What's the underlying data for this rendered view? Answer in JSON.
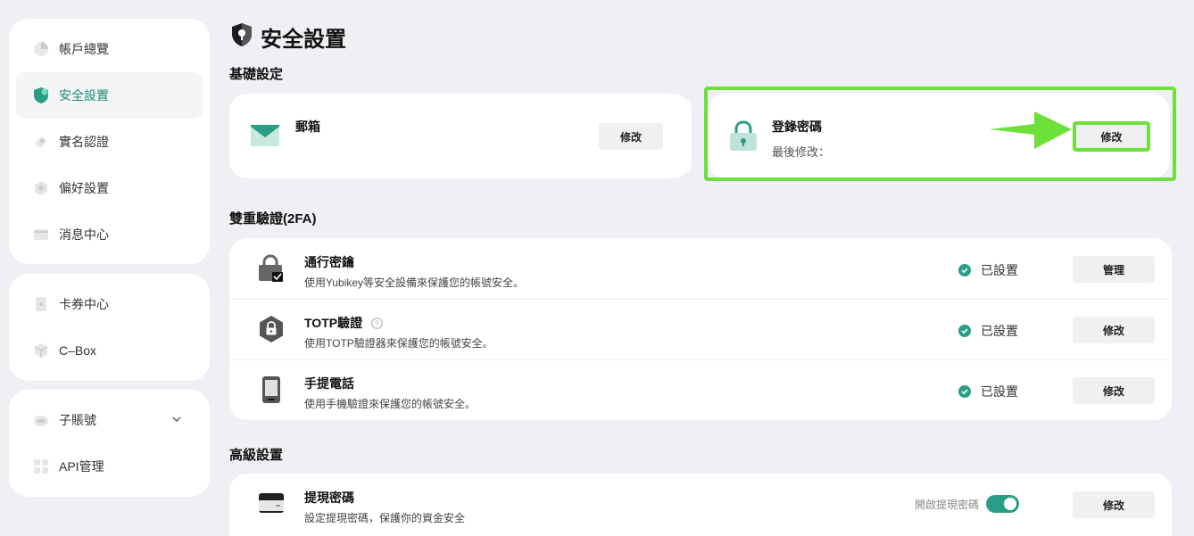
{
  "sidebar": {
    "group1": [
      {
        "label": "帳戶總覽",
        "icon": "pie-chart-icon"
      },
      {
        "label": "安全設置",
        "icon": "shield-icon",
        "active": true
      },
      {
        "label": "實名認證",
        "icon": "id-badge-icon"
      },
      {
        "label": "偏好設置",
        "icon": "settings-icon"
      },
      {
        "label": "消息中心",
        "icon": "message-icon"
      }
    ],
    "group2": [
      {
        "label": "卡券中心",
        "icon": "coupon-icon"
      },
      {
        "label": "C–Box",
        "icon": "box-icon"
      }
    ],
    "group3": [
      {
        "label": "子賬號",
        "icon": "sub-account-icon"
      },
      {
        "label": "API管理",
        "icon": "api-icon"
      }
    ]
  },
  "page": {
    "title": "安全設置",
    "icon": "security-shield-icon"
  },
  "basic": {
    "title": "基礎設定",
    "email": {
      "title": "郵箱",
      "value": "",
      "button": "修改"
    },
    "password": {
      "title": "登錄密碼",
      "desc": "最後修改：",
      "button": "修改"
    }
  },
  "twofa": {
    "title": "雙重驗證(2FA)",
    "rows": [
      {
        "title": "通行密鑰",
        "desc": "使用Yubikey等安全設備來保護您的帳號安全。",
        "status": "已設置",
        "button": "管理"
      },
      {
        "title": "TOTP驗證",
        "desc": "使用TOTP驗證器來保護您的帳號安全。",
        "status": "已設置",
        "button": "修改"
      },
      {
        "title": "手提電話",
        "desc": "使用手機驗證來保護您的帳號安全。",
        "status": "已設置",
        "button": "修改"
      }
    ]
  },
  "advanced": {
    "title": "高級設置",
    "withdraw": {
      "title": "提現密碼",
      "desc": "設定提現密碼，保護你的資金安全",
      "toggle_label": "開啟提現密碼",
      "toggle_on": true,
      "button": "修改"
    }
  },
  "colors": {
    "accent": "#2a9d87",
    "highlight": "#6ee03a"
  }
}
